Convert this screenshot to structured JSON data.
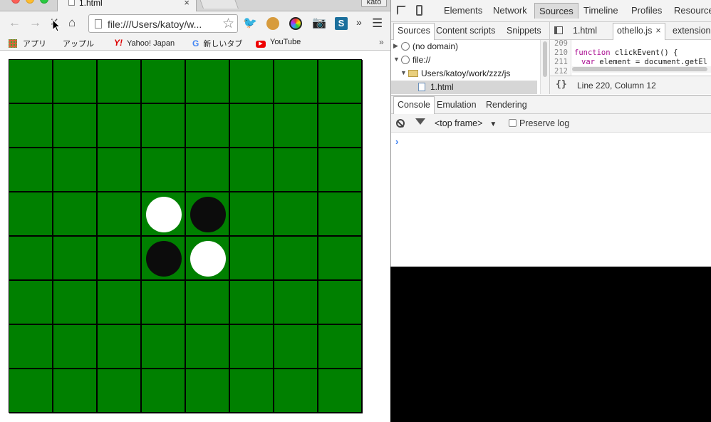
{
  "browser": {
    "tab": {
      "title": "1.html",
      "close_glyph": "×"
    },
    "profile": "kato",
    "toolbar": {
      "back_glyph": "←",
      "forward_glyph": "→",
      "stop_glyph": "✕",
      "home_glyph": "⌂",
      "url": "file:///Users/katoy/w...",
      "star_glyph": "☆",
      "overflow_glyph": "»",
      "menu_glyph": "☰",
      "extensions": [
        "twitter-icon",
        "cookie-icon",
        "color-picker-icon",
        "camera-icon",
        "s-icon"
      ]
    },
    "bookmarks": {
      "items": [
        {
          "label": "アプリ",
          "icon": "apps-grid-icon"
        },
        {
          "label": "アップル",
          "icon": "apple-icon"
        },
        {
          "label": "Yahoo! Japan",
          "icon": "yahoo-icon"
        },
        {
          "label": "新しいタブ",
          "icon": "google-icon"
        },
        {
          "label": "YouTube",
          "icon": "youtube-icon"
        }
      ],
      "overflow_glyph": "»"
    }
  },
  "board": {
    "size": 8,
    "cell_color": "#008000",
    "line_color": "#000000",
    "stones": [
      {
        "row": 3,
        "col": 3,
        "color": "white"
      },
      {
        "row": 3,
        "col": 4,
        "color": "black"
      },
      {
        "row": 4,
        "col": 3,
        "color": "black"
      },
      {
        "row": 4,
        "col": 4,
        "color": "white"
      }
    ]
  },
  "devtools": {
    "main_tabs": [
      "Elements",
      "Network",
      "Sources",
      "Timeline",
      "Profiles",
      "Resources"
    ],
    "active_main_tab": "Sources",
    "navigator_tabs": [
      "Sources",
      "Content scripts",
      "Snippets"
    ],
    "tree": {
      "no_domain": "(no domain)",
      "file": "file://",
      "folder": "Users/katoy/work/zzz/js",
      "html": "1.html"
    },
    "editor_tabs": [
      "1.html",
      "othello.js",
      "extension"
    ],
    "editor_tab_close": "×",
    "code": {
      "line_numbers": [
        "209",
        "210",
        "211",
        "212"
      ],
      "line_210_keyword": "function",
      "line_210_rest": " clickEvent() {",
      "line_211_keyword": "var",
      "line_211_rest": " element = document.getEl"
    },
    "pretty_print": "{}",
    "status": "Line 220, Column 12",
    "drawer_tabs": [
      "Console",
      "Emulation",
      "Rendering"
    ],
    "console": {
      "frame": "<top frame>",
      "frame_caret": "▼",
      "preserve_log": "Preserve log",
      "prompt": "›"
    }
  }
}
